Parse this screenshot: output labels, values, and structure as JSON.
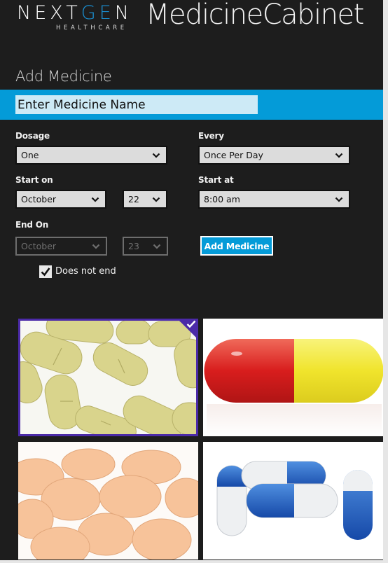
{
  "brand": {
    "logo_part1": "NEXT",
    "logo_accent": "GE",
    "logo_part2": "N",
    "logo_sub": "HEALTHCARE",
    "app_title": "MedicineCabinet"
  },
  "form": {
    "title": "Add Medicine",
    "name_placeholder": "Enter Medicine Name",
    "name_value": "",
    "dosage": {
      "label": "Dosage",
      "value": "One"
    },
    "every": {
      "label": "Every",
      "value": "Once Per Day"
    },
    "start_on": {
      "label": "Start on",
      "month": "October",
      "day": "22"
    },
    "start_at": {
      "label": "Start at",
      "value": "8:00 am"
    },
    "end_on": {
      "label": "End On",
      "month": "October",
      "day": "23",
      "disabled": true
    },
    "add_button": "Add Medicine",
    "does_not_end": {
      "label": "Does not end",
      "checked": true
    }
  },
  "images": [
    {
      "name": "yellow-oval-tablets",
      "selected": true
    },
    {
      "name": "red-yellow-capsule",
      "selected": false
    },
    {
      "name": "peach-round-tablets",
      "selected": false
    },
    {
      "name": "blue-white-capsules",
      "selected": false
    }
  ],
  "colors": {
    "accent": "#049bd8",
    "background": "#1d1d1d",
    "selection": "#4b2aa8",
    "input_fill": "#cdeaf6"
  },
  "icons": {
    "dropdown": "chevron-down-icon",
    "checkbox": "checkmark-icon",
    "selected": "checkmark-icon"
  }
}
